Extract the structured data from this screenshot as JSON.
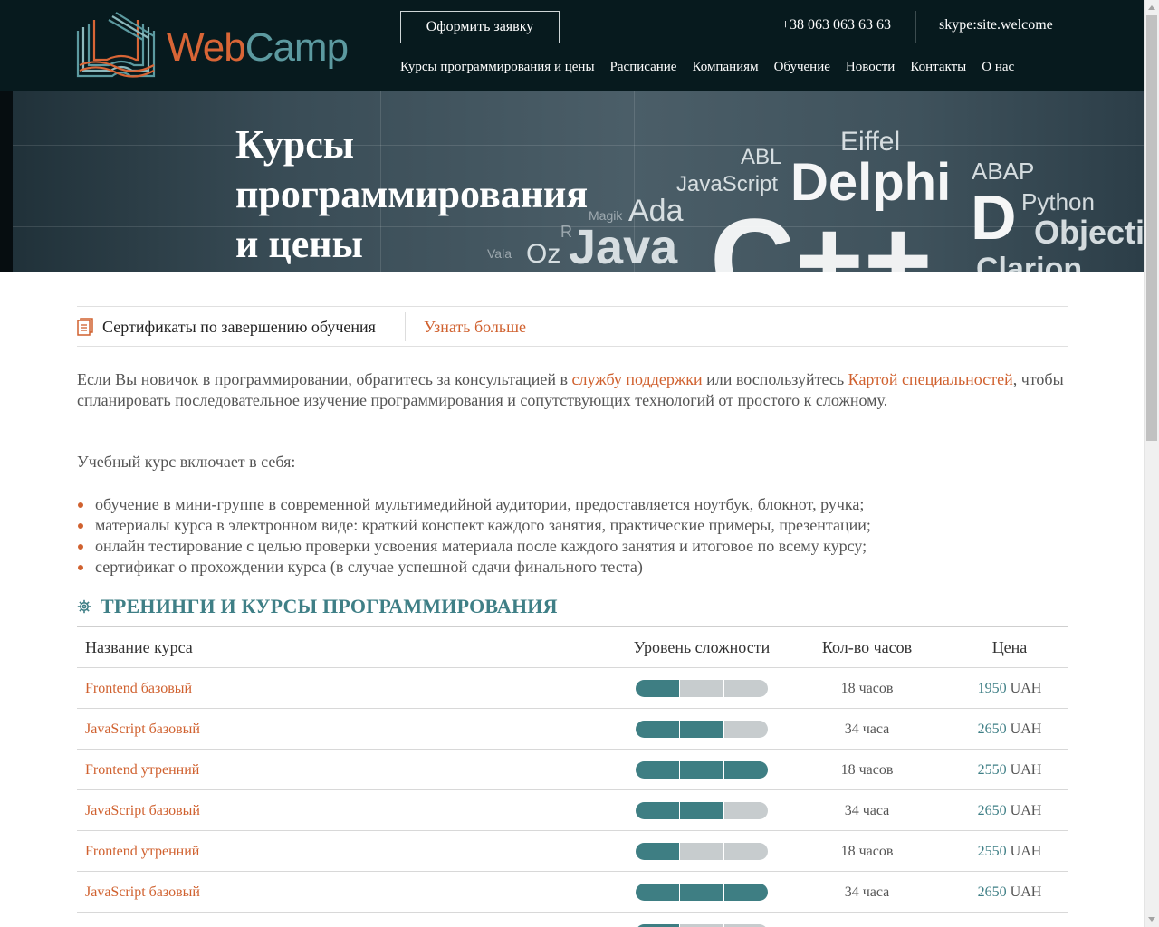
{
  "header": {
    "logo_web": "Web",
    "logo_camp": "Camp",
    "order_button": "Оформить заявку",
    "phone": "+38 063 063 63 63",
    "skype": "skype:site.welcome",
    "nav": [
      "Курсы программирования и цены",
      "Расписание",
      "Компаниям",
      "Обучение",
      "Новости",
      "Контакты",
      "О нас"
    ]
  },
  "banner": {
    "title": "Курсы программирования и цены",
    "words": [
      "Eiffel",
      "ABL",
      "JavaScript",
      "Delphi",
      "ABAP",
      "Python",
      "D",
      "Objectiv",
      "Ada",
      "Magik",
      "Java",
      "Oz",
      "R",
      "Vala",
      "C++",
      "Clarion"
    ]
  },
  "certificates": {
    "text": "Сертификаты по завершению обучения",
    "link": "Узнать больше"
  },
  "intro": {
    "part1": "Если Вы новичок в программировании, обратитесь за консультацией в ",
    "link1": "службу поддержки",
    "part2": " или воспользуйтесь ",
    "link2": "Картой специальностей",
    "part3": ", чтобы спланировать последовательное изучение программирования и сопутствующих технологий от простого к сложному."
  },
  "includes_title": "Учебный курс включает в себя:",
  "bullets": [
    "обучение в мини-группе в современной мультимедийной аудитории, предоставляется ноутбук, блокнот, ручка;",
    "материалы курса в электронном виде: краткий конспект каждого занятия, практические примеры, презентации;",
    "онлайн тестирование с целью проверки усвоения материала после каждого занятия и итоговое по всему курсу;",
    "сертификат о прохождении курса (в случае успешной сдачи финального теста)"
  ],
  "section_title": "Тренинги и курсы программирования",
  "table": {
    "headers": {
      "name": "Название курса",
      "level": "Уровень сложности",
      "hours": "Кол-во часов",
      "price": "Цена"
    },
    "rows": [
      {
        "name": "Frontend базовый",
        "level": 1,
        "hours": "18 часов",
        "price": "1950",
        "currency": "UAH"
      },
      {
        "name": "JavaScript базовый",
        "level": 2,
        "hours": "34 часа",
        "price": "2650",
        "currency": "UAH"
      },
      {
        "name": "Frontend утренний",
        "level": 3,
        "hours": "18 часов",
        "price": "2550",
        "currency": "UAH"
      },
      {
        "name": "JavaScript базовый",
        "level": 2,
        "hours": "34 часа",
        "price": "2650",
        "currency": "UAH"
      },
      {
        "name": "Frontend утренний",
        "level": 1,
        "hours": "18 часов",
        "price": "2550",
        "currency": "UAH"
      },
      {
        "name": "JavaScript базовый",
        "level": 3,
        "hours": "34 часа",
        "price": "2650",
        "currency": "UAH"
      },
      {
        "name": "",
        "level": 1,
        "hours": "",
        "price": "",
        "currency": ""
      }
    ]
  },
  "colors": {
    "accent": "#d0612f",
    "teal": "#3f7f86",
    "header_bg": "#071a1e",
    "meter_on": "#3e7e83",
    "meter_off": "#c7ccce"
  }
}
